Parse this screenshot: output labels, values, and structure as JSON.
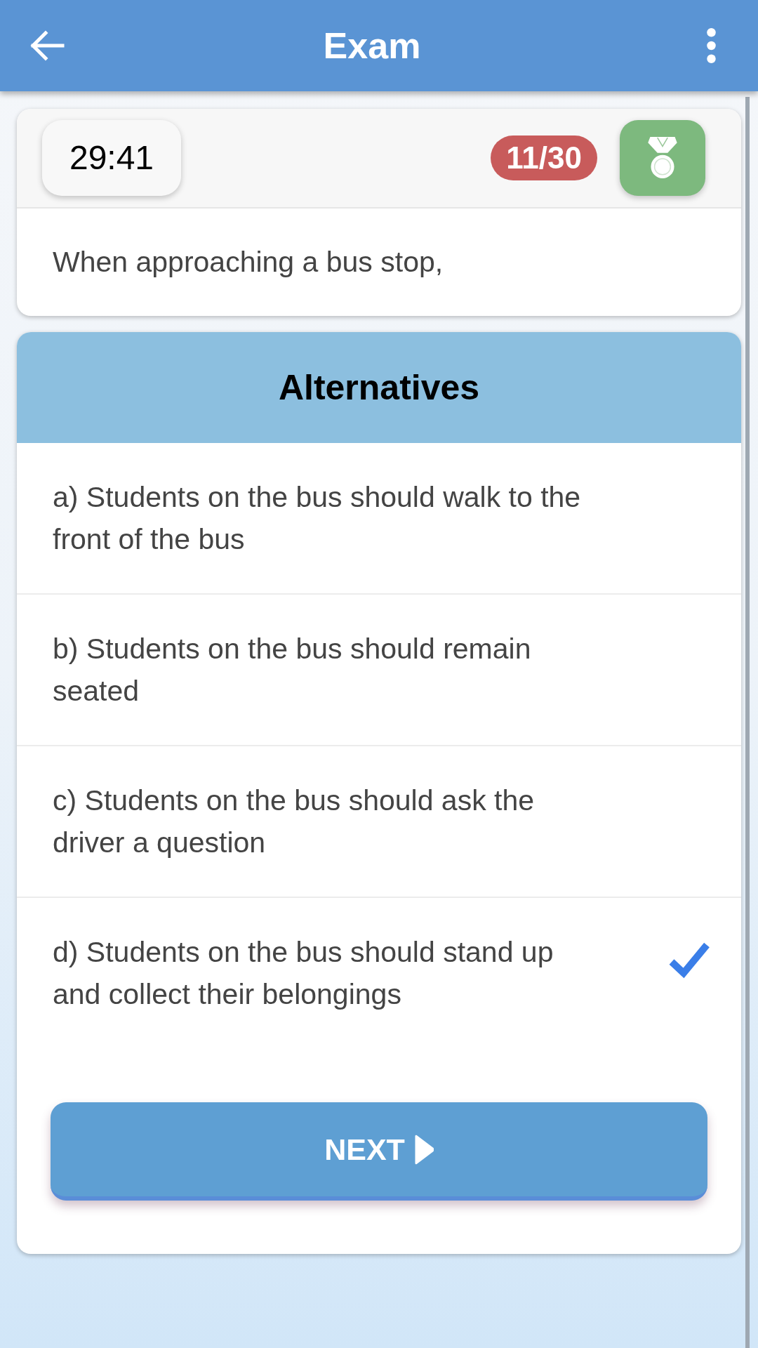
{
  "app_bar": {
    "title": "Exam"
  },
  "status": {
    "timer": "29:41",
    "counter": "11/30"
  },
  "question": "When approaching a bus stop,",
  "alternatives": {
    "title": "Alternatives",
    "options": [
      {
        "text": "a) Students on the bus should walk to the front of the bus",
        "selected": false
      },
      {
        "text": "b) Students on the bus should remain seated",
        "selected": false
      },
      {
        "text": "c) Students on the bus should ask the driver a question",
        "selected": false
      },
      {
        "text": "d) Students on the bus should stand up and collect their belongings",
        "selected": true
      }
    ]
  },
  "next_button": {
    "label": "NEXT"
  }
}
